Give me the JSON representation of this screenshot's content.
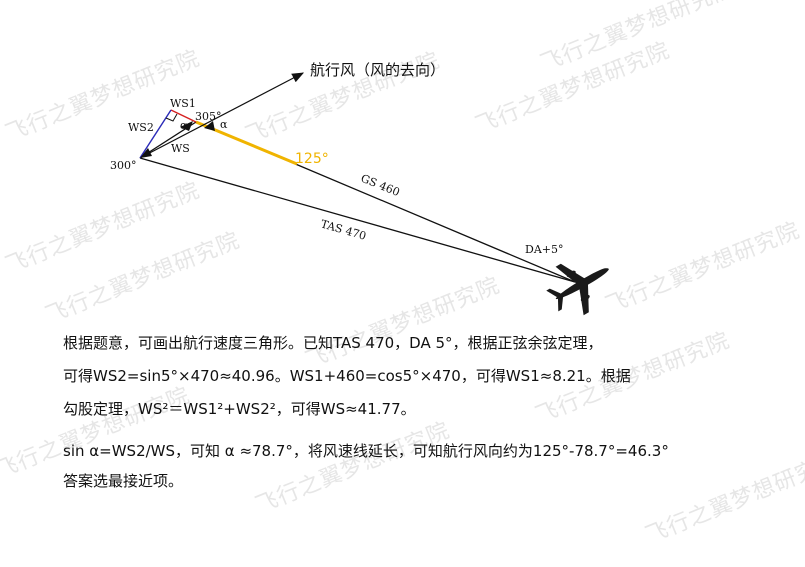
{
  "watermark": "飞行之翼梦想研究院",
  "diagram": {
    "wind_direction_label": "航行风（风的去向）",
    "ws1_label": "WS1",
    "ws2_label": "WS2",
    "ws_label": "WS",
    "alpha_label_1": "α",
    "alpha_label_2": "α",
    "heading_305_label": "305°",
    "heading_300_label": "300°",
    "heading_125_label": "125°",
    "gs_label": "GS 460",
    "tas_label": "TAS 470",
    "da_label": "DA+5°",
    "colors": {
      "ws1": "#d62020",
      "ws2": "#2a2ab8",
      "track_125": "#f0b400",
      "lines": "#111111",
      "aircraft": "#1a1a1a"
    }
  },
  "explanation": {
    "line1": "根据题意，可画出航行速度三角形。已知TAS 470，DA 5°，根据正弦余弦定理，",
    "line2": "可得WS2=sin5°×470≈40.96。WS1+460=cos5°×470，可得WS1≈8.21。根据",
    "line3": "勾股定理，WS²＝WS1²+WS2²，可得WS≈41.77。",
    "line4": "sin α=WS2/WS，可知 α ≈78.7°，将风速线延长，可知航行风向约为125°-78.7°=46.3°",
    "line5": "答案选最接近项。"
  }
}
